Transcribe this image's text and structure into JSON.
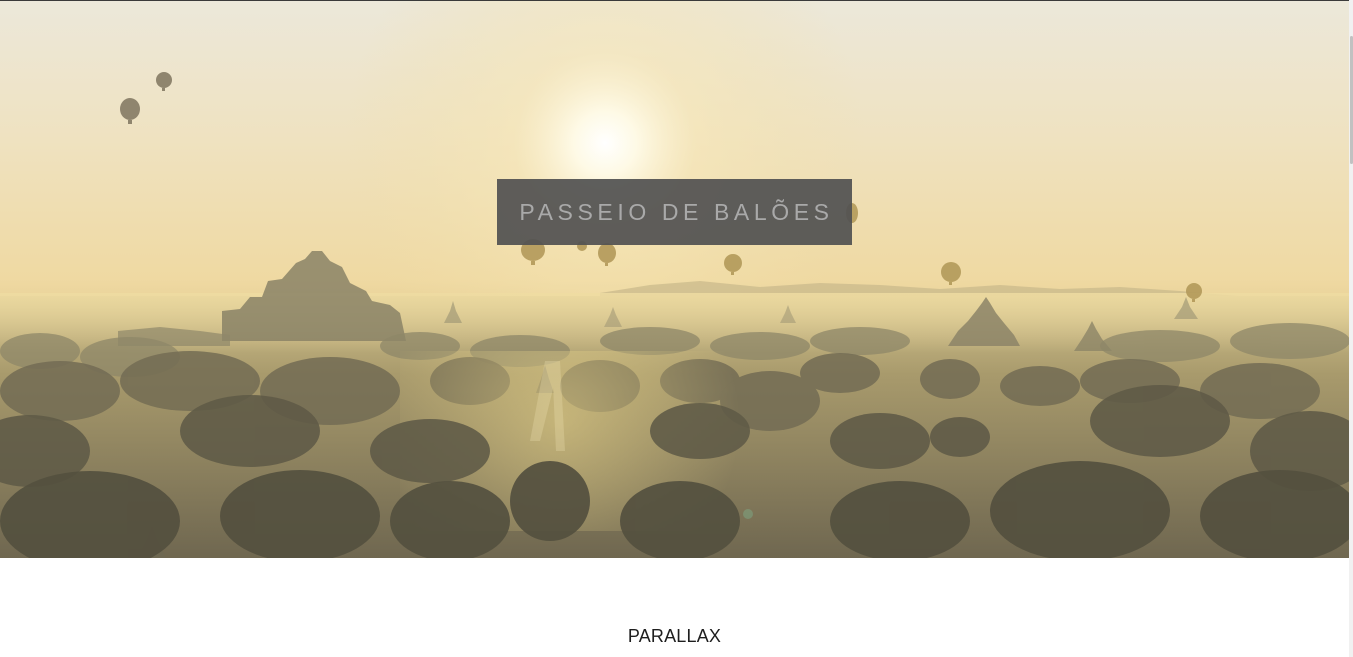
{
  "hero": {
    "title": "PASSEIO DE BALÕES",
    "image": "hot-air-balloons-over-temples-at-sunrise"
  },
  "section": {
    "heading": "PARALLAX"
  },
  "colors": {
    "title_box": "#525252",
    "title_text": "#a9a9a9",
    "heading_text": "#1e1e1e",
    "page_background": "#ffffff"
  }
}
